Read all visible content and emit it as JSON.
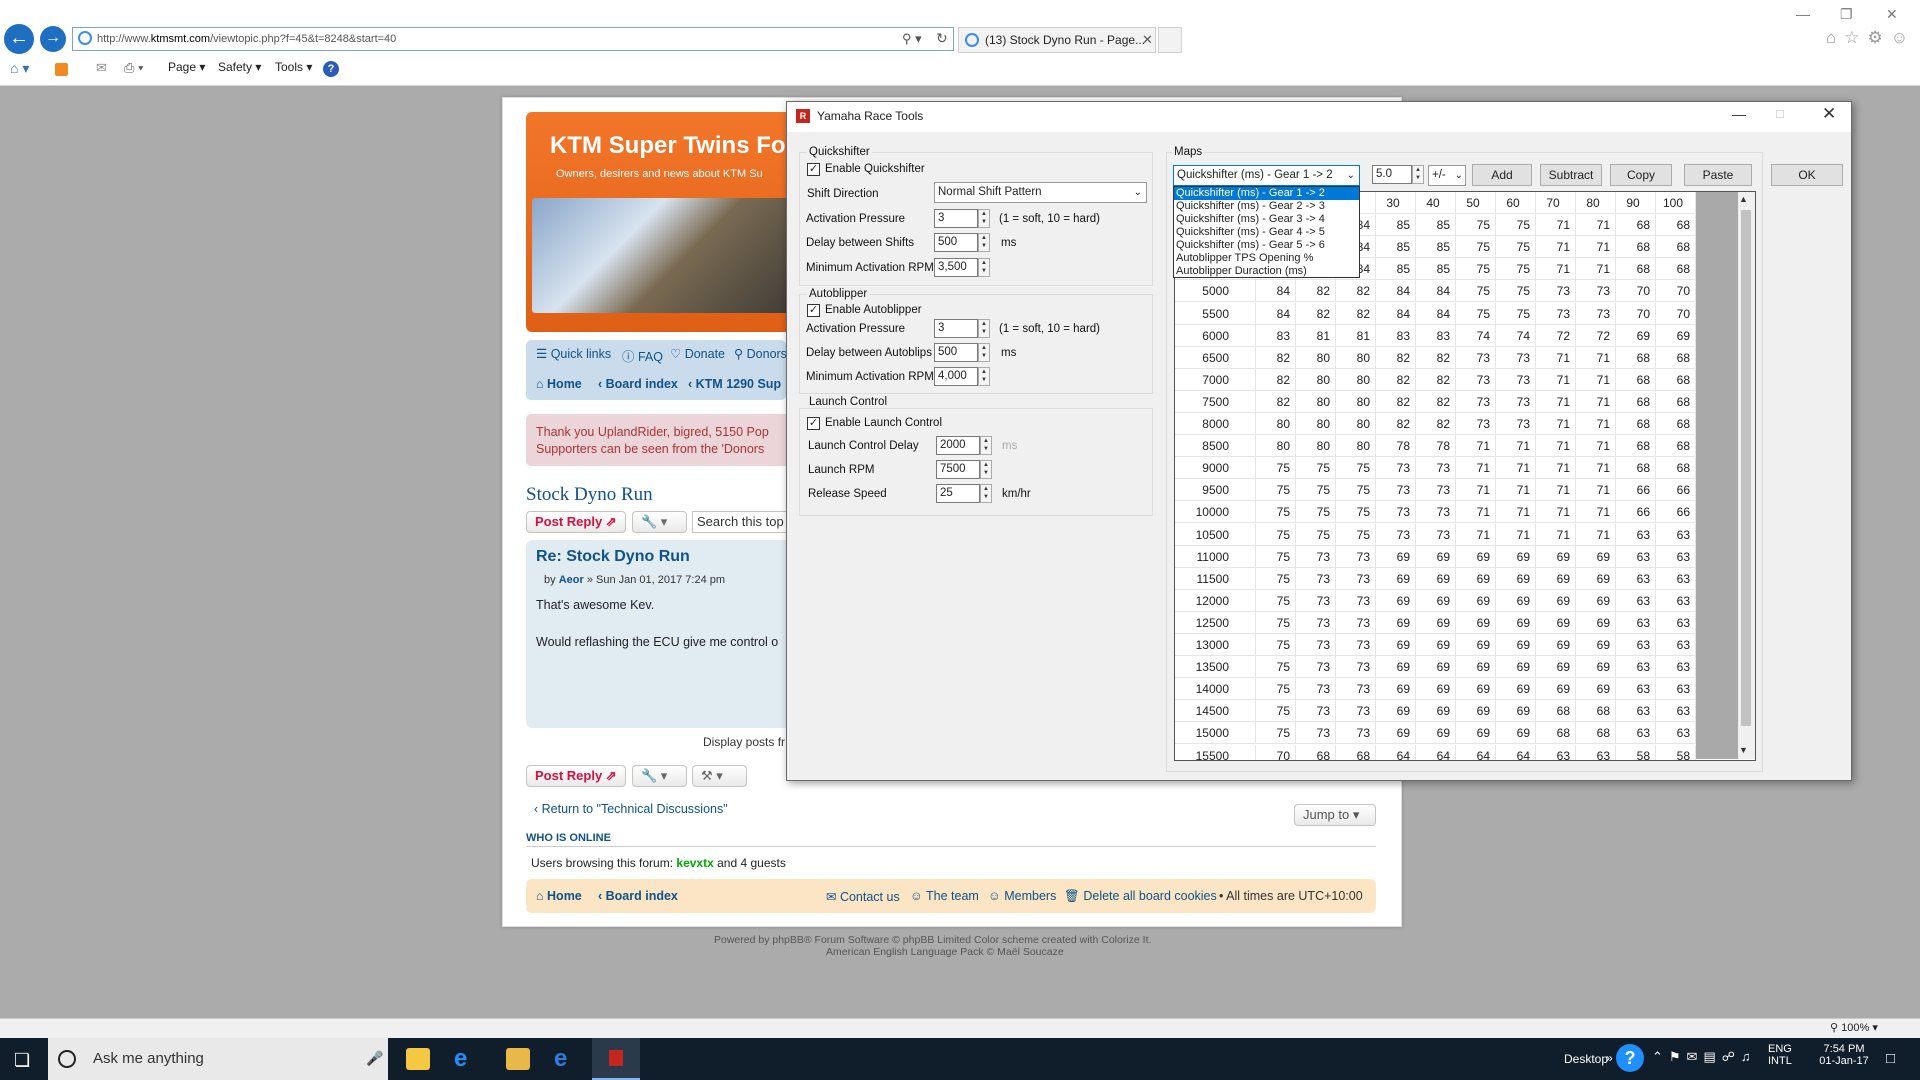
{
  "browser": {
    "url_prefix": "http://www.",
    "url_domain": "ktmsmt.com",
    "url_path": "/viewtopic.php?f=45&t=8248&start=40",
    "tab_title": "(13) Stock Dyno Run - Page...",
    "menu": {
      "page": "Page",
      "safety": "Safety",
      "tools": "Tools"
    },
    "zoom": "100%"
  },
  "forum": {
    "title": "KTM Super Twins For",
    "description": "Owners, desirers and news about KTM Su",
    "nav": {
      "quick_links": "Quick links",
      "faq": "FAQ",
      "donate": "Donate",
      "donors": "Donors"
    },
    "breadcrumb": {
      "home": "Home",
      "board": "Board index",
      "forum": "KTM 1290 Sup"
    },
    "donors_text1": "Thank you UplandRider, bigred, 5150 Pop",
    "donors_text2": "Supporters can be seen from the 'Donors",
    "topic_title": "Stock Dyno Run",
    "post_reply": "Post Reply",
    "search_placeholder": "Search this top",
    "post_title": "Re: Stock Dyno Run",
    "post_by": "by",
    "post_author": "Aeor",
    "post_date": "» Sun Jan 01, 2017 7:24 pm",
    "post_line1": "That's awesome Kev.",
    "post_line2": "Would reflashing the ECU give me control o",
    "display_posts": "Display posts fr",
    "return_link": "Return to \"Technical Discussions\"",
    "jump_to": "Jump to",
    "who_online": "WHO IS ONLINE",
    "browsing": "Users browsing this forum:",
    "online_user": "kevxtx",
    "online_guests": "and 4 guests",
    "footer": {
      "home": "Home",
      "board": "Board index",
      "contact": "Contact us",
      "team": "The team",
      "members": "Members",
      "delete_cookies": "Delete all board cookies",
      "times": "• All times are UTC+10:00"
    },
    "powered1": "Powered by phpBB® Forum Software © phpBB Limited Color scheme created with Colorize It.",
    "powered2": "American English Language Pack © Maël Soucaze"
  },
  "dialog": {
    "title": "Yamaha Race Tools",
    "quickshifter": {
      "group": "Quickshifter",
      "enable": "Enable Quickshifter",
      "direction_label": "Shift Direction",
      "direction_value": "Normal Shift Pattern",
      "pressure_label": "Activation Pressure",
      "pressure_value": "3",
      "pressure_hint": "(1 = soft, 10 = hard)",
      "delay_label": "Delay between Shifts",
      "delay_value": "500",
      "delay_unit": "ms",
      "rpm_label": "Minimum Activation RPM",
      "rpm_value": "3,500"
    },
    "autoblipper": {
      "group": "Autoblipper",
      "enable": "Enable Autoblipper",
      "pressure_label": "Activation Pressure",
      "pressure_value": "3",
      "pressure_hint": "(1 = soft, 10 = hard)",
      "delay_label": "Delay between Autoblips",
      "delay_value": "500",
      "delay_unit": "ms",
      "rpm_label": "Minimum Activation RPM",
      "rpm_value": "4,000"
    },
    "launch": {
      "group": "Launch Control",
      "enable": "Enable Launch Control",
      "delay_label": "Launch Control Delay",
      "delay_value": "2000",
      "delay_unit": "ms",
      "rpm_label": "Launch RPM",
      "rpm_value": "7500",
      "speed_label": "Release Speed",
      "speed_value": "25",
      "speed_unit": "km/hr"
    },
    "maps": {
      "group": "Maps",
      "selected_map": "Quickshifter (ms) - Gear 1 -> 2",
      "step_value": "5.0",
      "op_value": "+/-",
      "add": "Add",
      "subtract": "Subtract",
      "copy": "Copy",
      "paste": "Paste",
      "ok": "OK",
      "options": [
        "Quickshifter (ms) - Gear 1 -> 2",
        "Quickshifter (ms) - Gear 2 -> 3",
        "Quickshifter (ms) - Gear 3 -> 4",
        "Quickshifter (ms) - Gear 4 -> 5",
        "Quickshifter (ms) - Gear 5 -> 6",
        "Autoblipper TPS Opening %",
        "Autoblipper Duraction (ms)"
      ],
      "columns": [
        "",
        "",
        "",
        "30",
        "40",
        "50",
        "60",
        "70",
        "80",
        "90",
        "100"
      ],
      "rows": [
        [
          "",
          "",
          "",
          "84",
          "85",
          "85",
          "75",
          "75",
          "71",
          "71",
          "68",
          "68"
        ],
        [
          "",
          "",
          "",
          "84",
          "85",
          "85",
          "75",
          "75",
          "71",
          "71",
          "68",
          "68"
        ],
        [
          "",
          "",
          "",
          "84",
          "85",
          "85",
          "75",
          "75",
          "71",
          "71",
          "68",
          "68"
        ],
        [
          "5000",
          "84",
          "82",
          "82",
          "84",
          "84",
          "75",
          "75",
          "73",
          "73",
          "70",
          "70"
        ],
        [
          "5500",
          "84",
          "82",
          "82",
          "84",
          "84",
          "75",
          "75",
          "73",
          "73",
          "70",
          "70"
        ],
        [
          "6000",
          "83",
          "81",
          "81",
          "83",
          "83",
          "74",
          "74",
          "72",
          "72",
          "69",
          "69"
        ],
        [
          "6500",
          "82",
          "80",
          "80",
          "82",
          "82",
          "73",
          "73",
          "71",
          "71",
          "68",
          "68"
        ],
        [
          "7000",
          "82",
          "80",
          "80",
          "82",
          "82",
          "73",
          "73",
          "71",
          "71",
          "68",
          "68"
        ],
        [
          "7500",
          "82",
          "80",
          "80",
          "82",
          "82",
          "73",
          "73",
          "71",
          "71",
          "68",
          "68"
        ],
        [
          "8000",
          "80",
          "80",
          "80",
          "82",
          "82",
          "73",
          "73",
          "71",
          "71",
          "68",
          "68"
        ],
        [
          "8500",
          "80",
          "80",
          "80",
          "78",
          "78",
          "71",
          "71",
          "71",
          "71",
          "68",
          "68"
        ],
        [
          "9000",
          "75",
          "75",
          "75",
          "73",
          "73",
          "71",
          "71",
          "71",
          "71",
          "68",
          "68"
        ],
        [
          "9500",
          "75",
          "75",
          "75",
          "73",
          "73",
          "71",
          "71",
          "71",
          "71",
          "66",
          "66"
        ],
        [
          "10000",
          "75",
          "75",
          "75",
          "73",
          "73",
          "71",
          "71",
          "71",
          "71",
          "66",
          "66"
        ],
        [
          "10500",
          "75",
          "75",
          "75",
          "73",
          "73",
          "71",
          "71",
          "71",
          "71",
          "63",
          "63"
        ],
        [
          "11000",
          "75",
          "73",
          "73",
          "69",
          "69",
          "69",
          "69",
          "69",
          "69",
          "63",
          "63"
        ],
        [
          "11500",
          "75",
          "73",
          "73",
          "69",
          "69",
          "69",
          "69",
          "69",
          "69",
          "63",
          "63"
        ],
        [
          "12000",
          "75",
          "73",
          "73",
          "69",
          "69",
          "69",
          "69",
          "69",
          "69",
          "63",
          "63"
        ],
        [
          "12500",
          "75",
          "73",
          "73",
          "69",
          "69",
          "69",
          "69",
          "69",
          "69",
          "63",
          "63"
        ],
        [
          "13000",
          "75",
          "73",
          "73",
          "69",
          "69",
          "69",
          "69",
          "69",
          "69",
          "63",
          "63"
        ],
        [
          "13500",
          "75",
          "73",
          "73",
          "69",
          "69",
          "69",
          "69",
          "69",
          "69",
          "63",
          "63"
        ],
        [
          "14000",
          "75",
          "73",
          "73",
          "69",
          "69",
          "69",
          "69",
          "69",
          "69",
          "63",
          "63"
        ],
        [
          "14500",
          "75",
          "73",
          "73",
          "69",
          "69",
          "69",
          "69",
          "68",
          "68",
          "63",
          "63"
        ],
        [
          "15000",
          "75",
          "73",
          "73",
          "69",
          "69",
          "69",
          "69",
          "68",
          "68",
          "63",
          "63"
        ],
        [
          "15500",
          "70",
          "68",
          "68",
          "64",
          "64",
          "64",
          "64",
          "63",
          "63",
          "58",
          "58"
        ]
      ]
    }
  },
  "taskbar": {
    "search": "Ask me anything",
    "desktop": "Desktop",
    "lang1": "ENG",
    "lang2": "INTL",
    "time": "7:54 PM",
    "date": "01-Jan-17"
  }
}
